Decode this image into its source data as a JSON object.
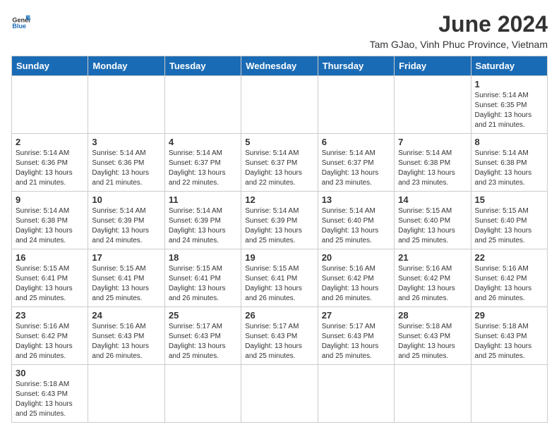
{
  "header": {
    "logo_general": "General",
    "logo_blue": "Blue",
    "month_year": "June 2024",
    "location": "Tam GJao, Vinh Phuc Province, Vietnam"
  },
  "days_of_week": [
    "Sunday",
    "Monday",
    "Tuesday",
    "Wednesday",
    "Thursday",
    "Friday",
    "Saturday"
  ],
  "weeks": [
    [
      {
        "day": null,
        "info": null
      },
      {
        "day": null,
        "info": null
      },
      {
        "day": null,
        "info": null
      },
      {
        "day": null,
        "info": null
      },
      {
        "day": null,
        "info": null
      },
      {
        "day": null,
        "info": null
      },
      {
        "day": "1",
        "info": "Sunrise: 5:14 AM\nSunset: 6:35 PM\nDaylight: 13 hours\nand 21 minutes."
      }
    ],
    [
      {
        "day": "2",
        "info": "Sunrise: 5:14 AM\nSunset: 6:36 PM\nDaylight: 13 hours\nand 21 minutes."
      },
      {
        "day": "3",
        "info": "Sunrise: 5:14 AM\nSunset: 6:36 PM\nDaylight: 13 hours\nand 21 minutes."
      },
      {
        "day": "4",
        "info": "Sunrise: 5:14 AM\nSunset: 6:37 PM\nDaylight: 13 hours\nand 22 minutes."
      },
      {
        "day": "5",
        "info": "Sunrise: 5:14 AM\nSunset: 6:37 PM\nDaylight: 13 hours\nand 22 minutes."
      },
      {
        "day": "6",
        "info": "Sunrise: 5:14 AM\nSunset: 6:37 PM\nDaylight: 13 hours\nand 23 minutes."
      },
      {
        "day": "7",
        "info": "Sunrise: 5:14 AM\nSunset: 6:38 PM\nDaylight: 13 hours\nand 23 minutes."
      },
      {
        "day": "8",
        "info": "Sunrise: 5:14 AM\nSunset: 6:38 PM\nDaylight: 13 hours\nand 23 minutes."
      }
    ],
    [
      {
        "day": "9",
        "info": "Sunrise: 5:14 AM\nSunset: 6:38 PM\nDaylight: 13 hours\nand 24 minutes."
      },
      {
        "day": "10",
        "info": "Sunrise: 5:14 AM\nSunset: 6:39 PM\nDaylight: 13 hours\nand 24 minutes."
      },
      {
        "day": "11",
        "info": "Sunrise: 5:14 AM\nSunset: 6:39 PM\nDaylight: 13 hours\nand 24 minutes."
      },
      {
        "day": "12",
        "info": "Sunrise: 5:14 AM\nSunset: 6:39 PM\nDaylight: 13 hours\nand 25 minutes."
      },
      {
        "day": "13",
        "info": "Sunrise: 5:14 AM\nSunset: 6:40 PM\nDaylight: 13 hours\nand 25 minutes."
      },
      {
        "day": "14",
        "info": "Sunrise: 5:15 AM\nSunset: 6:40 PM\nDaylight: 13 hours\nand 25 minutes."
      },
      {
        "day": "15",
        "info": "Sunrise: 5:15 AM\nSunset: 6:40 PM\nDaylight: 13 hours\nand 25 minutes."
      }
    ],
    [
      {
        "day": "16",
        "info": "Sunrise: 5:15 AM\nSunset: 6:41 PM\nDaylight: 13 hours\nand 25 minutes."
      },
      {
        "day": "17",
        "info": "Sunrise: 5:15 AM\nSunset: 6:41 PM\nDaylight: 13 hours\nand 25 minutes."
      },
      {
        "day": "18",
        "info": "Sunrise: 5:15 AM\nSunset: 6:41 PM\nDaylight: 13 hours\nand 26 minutes."
      },
      {
        "day": "19",
        "info": "Sunrise: 5:15 AM\nSunset: 6:41 PM\nDaylight: 13 hours\nand 26 minutes."
      },
      {
        "day": "20",
        "info": "Sunrise: 5:16 AM\nSunset: 6:42 PM\nDaylight: 13 hours\nand 26 minutes."
      },
      {
        "day": "21",
        "info": "Sunrise: 5:16 AM\nSunset: 6:42 PM\nDaylight: 13 hours\nand 26 minutes."
      },
      {
        "day": "22",
        "info": "Sunrise: 5:16 AM\nSunset: 6:42 PM\nDaylight: 13 hours\nand 26 minutes."
      }
    ],
    [
      {
        "day": "23",
        "info": "Sunrise: 5:16 AM\nSunset: 6:42 PM\nDaylight: 13 hours\nand 26 minutes."
      },
      {
        "day": "24",
        "info": "Sunrise: 5:16 AM\nSunset: 6:43 PM\nDaylight: 13 hours\nand 26 minutes."
      },
      {
        "day": "25",
        "info": "Sunrise: 5:17 AM\nSunset: 6:43 PM\nDaylight: 13 hours\nand 25 minutes."
      },
      {
        "day": "26",
        "info": "Sunrise: 5:17 AM\nSunset: 6:43 PM\nDaylight: 13 hours\nand 25 minutes."
      },
      {
        "day": "27",
        "info": "Sunrise: 5:17 AM\nSunset: 6:43 PM\nDaylight: 13 hours\nand 25 minutes."
      },
      {
        "day": "28",
        "info": "Sunrise: 5:18 AM\nSunset: 6:43 PM\nDaylight: 13 hours\nand 25 minutes."
      },
      {
        "day": "29",
        "info": "Sunrise: 5:18 AM\nSunset: 6:43 PM\nDaylight: 13 hours\nand 25 minutes."
      }
    ],
    [
      {
        "day": "30",
        "info": "Sunrise: 5:18 AM\nSunset: 6:43 PM\nDaylight: 13 hours\nand 25 minutes."
      },
      {
        "day": null,
        "info": null
      },
      {
        "day": null,
        "info": null
      },
      {
        "day": null,
        "info": null
      },
      {
        "day": null,
        "info": null
      },
      {
        "day": null,
        "info": null
      },
      {
        "day": null,
        "info": null
      }
    ]
  ]
}
